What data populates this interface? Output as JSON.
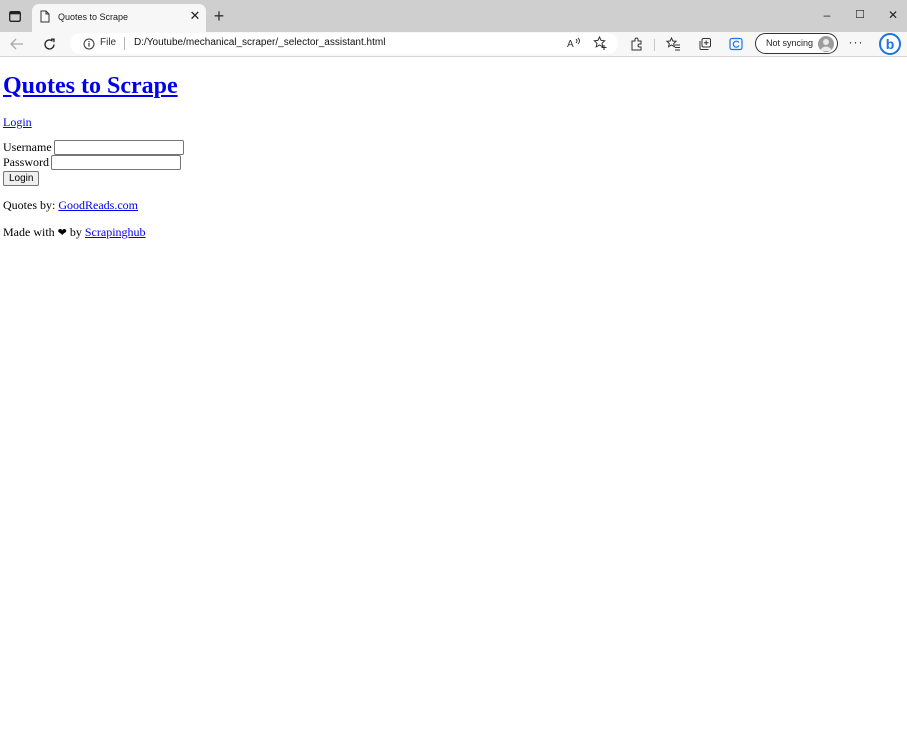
{
  "browser": {
    "tab": {
      "title": "Quotes to Scrape",
      "close_glyph": "✕"
    },
    "new_tab_glyph": "+",
    "window_controls": {
      "minimize": "–",
      "maximize": "☐",
      "close": "✕"
    },
    "address": {
      "scheme_label": "File",
      "url": "D:/Youtube/mechanical_scraper/_selector_assistant.html"
    },
    "profile": {
      "label": "Not syncing"
    },
    "more_glyph": "···",
    "copilot_glyph": "b",
    "icons": [
      "tab-actions-icon",
      "page-icon",
      "back-icon",
      "refresh-icon",
      "info-icon",
      "read-aloud-icon",
      "add-favorite-icon",
      "extensions-icon",
      "favorites-icon",
      "collections-icon",
      "browser-essentials-icon",
      "avatar-icon",
      "more-icon",
      "copilot-icon"
    ]
  },
  "page": {
    "title": "Quotes to Scrape",
    "login_link": "Login",
    "form": {
      "username_label": "Username",
      "username_value": "",
      "password_label": "Password",
      "password_value": "",
      "submit_label": "Login"
    },
    "footer": {
      "quotes_prefix": "Quotes by: ",
      "quotes_link": "GoodReads.com",
      "made_prefix": "Made with ",
      "heart_glyph": "❤",
      "made_middle": " by ",
      "made_link": "Scrapinghub"
    }
  }
}
